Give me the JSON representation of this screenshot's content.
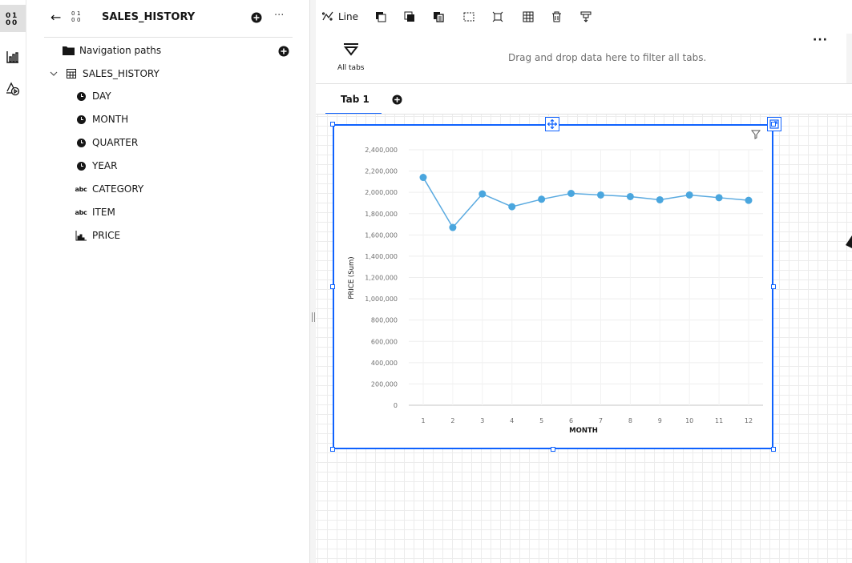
{
  "app": {
    "dataset_title": "SALES_HISTORY"
  },
  "panel": {
    "nav_paths_label": "Navigation paths",
    "table_label": "SALES_HISTORY",
    "fields": [
      {
        "label": "DAY",
        "type": "time"
      },
      {
        "label": "MONTH",
        "type": "time"
      },
      {
        "label": "QUARTER",
        "type": "time"
      },
      {
        "label": "YEAR",
        "type": "time"
      },
      {
        "label": "CATEGORY",
        "type": "text",
        "type_badge": "abc"
      },
      {
        "label": "ITEM",
        "type": "text",
        "type_badge": "abc"
      },
      {
        "label": "PRICE",
        "type": "measure"
      }
    ]
  },
  "toolbar": {
    "viz_type_label": "Line"
  },
  "filterbar": {
    "all_tabs_label": "All tabs",
    "drop_hint": "Drag and drop data here to filter all tabs."
  },
  "tabs": [
    {
      "label": "Tab 1",
      "active": true
    }
  ],
  "colors": {
    "accent": "#0f62fe",
    "series": "#5aaae0",
    "series_point": "#4aa6de"
  },
  "chart_data": {
    "type": "line",
    "xlabel": "MONTH",
    "ylabel": "PRICE (Sum)",
    "x": [
      1,
      2,
      3,
      4,
      5,
      6,
      7,
      8,
      9,
      10,
      11,
      12
    ],
    "x_tick_labels": [
      "1",
      "2",
      "3",
      "4",
      "5",
      "6",
      "7",
      "8",
      "9",
      "10",
      "11",
      "12"
    ],
    "series": [
      {
        "values": [
          2140000,
          1670000,
          1985000,
          1865000,
          1935000,
          1990000,
          1975000,
          1960000,
          1930000,
          1975000,
          1950000,
          1925000
        ]
      }
    ],
    "ylim": [
      0,
      2400000
    ],
    "y_ticks": [
      0,
      200000,
      400000,
      600000,
      800000,
      1000000,
      1200000,
      1400000,
      1600000,
      1800000,
      2000000,
      2200000,
      2400000
    ],
    "y_tick_labels": [
      "0",
      "200,000",
      "400,000",
      "600,000",
      "800,000",
      "1,000,000",
      "1,200,000",
      "1,400,000",
      "1,600,000",
      "1,800,000",
      "2,000,000",
      "2,200,000",
      "2,400,000"
    ],
    "grid": true
  }
}
